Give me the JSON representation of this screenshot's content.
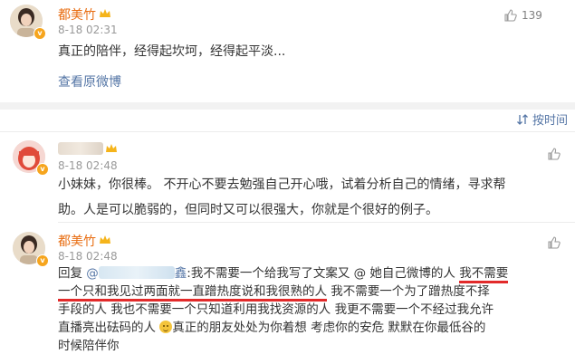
{
  "post": {
    "author": "都美竹",
    "time": "8-18 02:31",
    "text": "真正的陪伴，经得起坎坷，经得起平淡...",
    "likes": "139",
    "view_original": "查看原微博"
  },
  "sort_label": "按时间",
  "comments": [
    {
      "time": "8-18 02:48",
      "text_line1": "小妹妹，你很棒。 不开心不要去勉强自己开心哦，试着分析自己的情绪，寻求帮",
      "text_line2": "助。人是可以脆弱的，但同时又可以很强大，你就是个很好的例子。"
    },
    {
      "author": "都美竹",
      "time": "8-18 02:48",
      "reply_prefix": "回复",
      "mention_at": "@",
      "mention_tail": "鑫",
      "l1_a": ":我不需要一个给我写了文案又 @ 她自己微博的人 ",
      "l1_b": "我不需要",
      "l2_a": "一个只和我见过两面就一直蹭热度说和我很熟的人",
      "l2_b": " 我不需要一个为了蹭热度不择",
      "l3": "手段的人 我也不需要一个只知道利用我找资源的人 我更不需要一个不经过我允许",
      "l4_a": "直播亮出砝码的人 ",
      "l4_b": "真正的朋友处处为你着想 考虑你的安危 默默在你最低谷的",
      "l5": "时候陪伴你"
    }
  ]
}
